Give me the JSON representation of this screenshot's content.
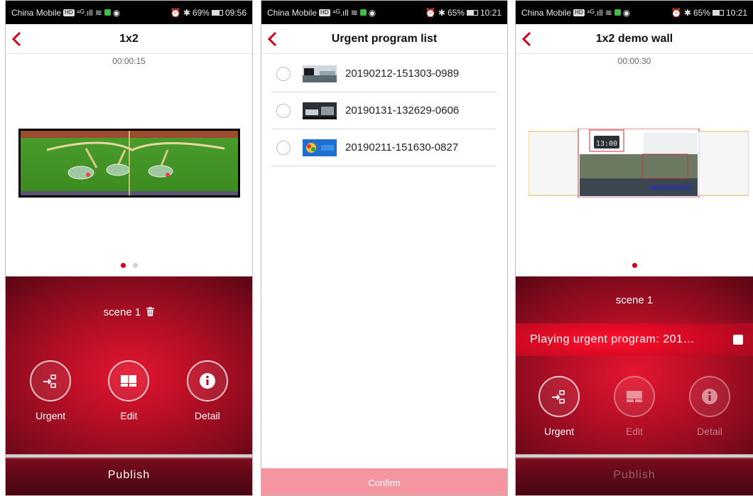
{
  "status_bars": [
    {
      "carrier": "China Mobile",
      "hd": "HD",
      "signal": "⁴ᴳ.ıll",
      "battery": "69%",
      "time": "09:56"
    },
    {
      "carrier": "China Mobile",
      "hd": "HD",
      "signal": "⁴ᴳ.ıll",
      "battery": "65%",
      "time": "10:21"
    },
    {
      "carrier": "China Mobile",
      "hd": "HD",
      "signal": "⁴ᴳ.ıll",
      "battery": "65%",
      "time": "10:21"
    }
  ],
  "screen1": {
    "title": "1x2",
    "timer": "00:00:15",
    "scene_label": "scene 1",
    "actions": {
      "urgent": "Urgent",
      "edit": "Edit",
      "detail": "Detail"
    },
    "publish": "Publish",
    "page_dots": {
      "count": 2,
      "active": 1
    }
  },
  "screen2": {
    "title": "Urgent program list",
    "items": [
      {
        "name": "20190212-151303-0989"
      },
      {
        "name": "20190131-132629-0606"
      },
      {
        "name": "20190211-151630-0827"
      }
    ],
    "confirm": "Confirm"
  },
  "screen3": {
    "title": "1x2 demo wall",
    "timer": "00:00:30",
    "scene_label": "scene 1",
    "urgent_playing": "Playing urgent program: 201…",
    "clock_text": "13:00",
    "actions": {
      "urgent": "Urgent",
      "edit": "Edit",
      "detail": "Detail"
    },
    "publish": "Publish",
    "page_dots": {
      "count": 1,
      "active": 1
    }
  },
  "colors": {
    "accent": "#d0021b",
    "panel_dark": "#7e0a1c",
    "confirm_bg": "#f4959f"
  }
}
